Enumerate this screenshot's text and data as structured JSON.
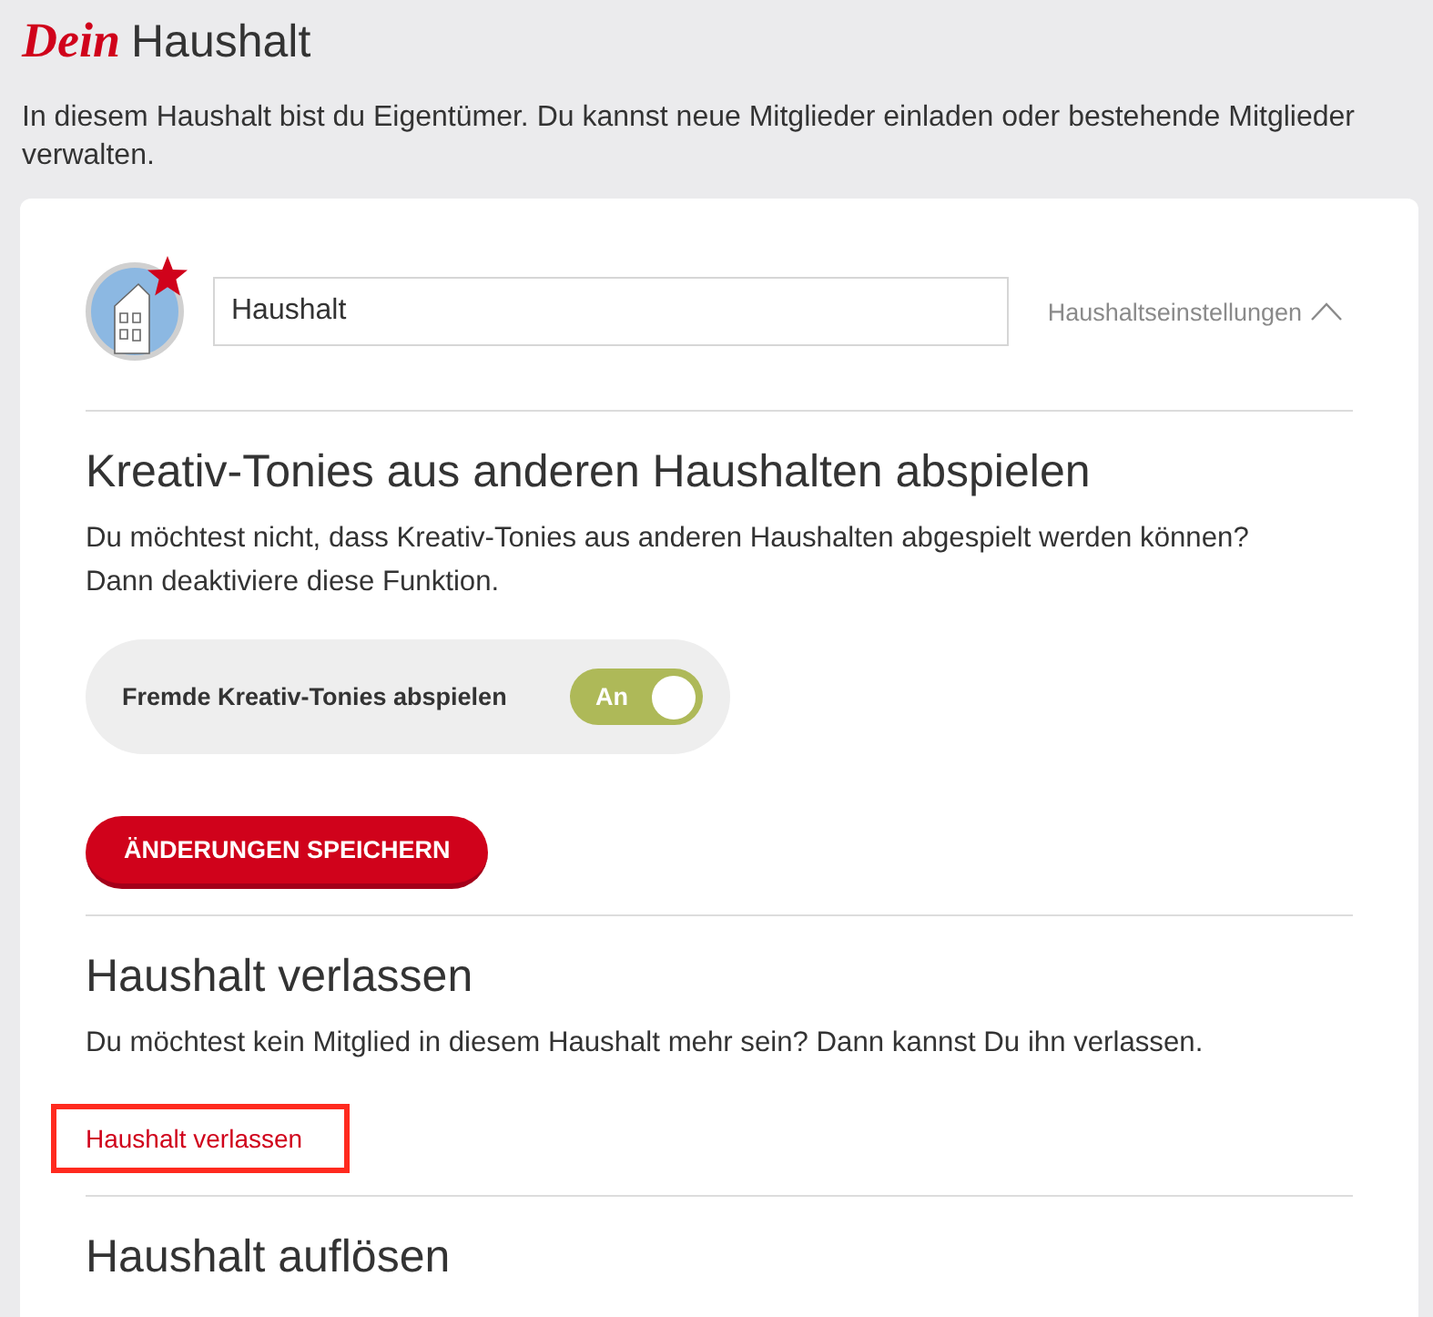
{
  "page_title": {
    "brand": "Dein",
    "text": "Haushalt"
  },
  "intro": "In diesem Haushalt bist du Eigentümer. Du kannst neue Mitglieder einladen oder bestehende Mitglieder verwalten.",
  "household": {
    "name_field": {
      "value": "Haushalt"
    },
    "settings_toggle": {
      "label": "Haushaltseinstellungen",
      "expanded": true
    }
  },
  "sections": [
    {
      "kind": "toggle",
      "heading": "Kreativ-Tonies aus anderen Haushalten abspielen",
      "text": "Du möchtest nicht, dass Kreativ-Tonies aus anderen Haushalten abgespielt werden können? Dann deaktiviere diese Funktion.",
      "setting": {
        "label": "Fremde Kreativ-Tonies abspielen",
        "on": true,
        "state_label": "An"
      },
      "button": "ÄNDERUNGEN SPEICHERN"
    },
    {
      "kind": "link",
      "heading": "Haushalt verlassen",
      "text": "Du möchtest kein Mitglied in diesem Haushalt mehr sein? Dann kannst Du ihn verlassen.",
      "link": {
        "label": "Haushalt verlassen",
        "highlighted": true
      }
    },
    {
      "kind": "heading",
      "heading": "Haushalt auflösen"
    }
  ]
}
